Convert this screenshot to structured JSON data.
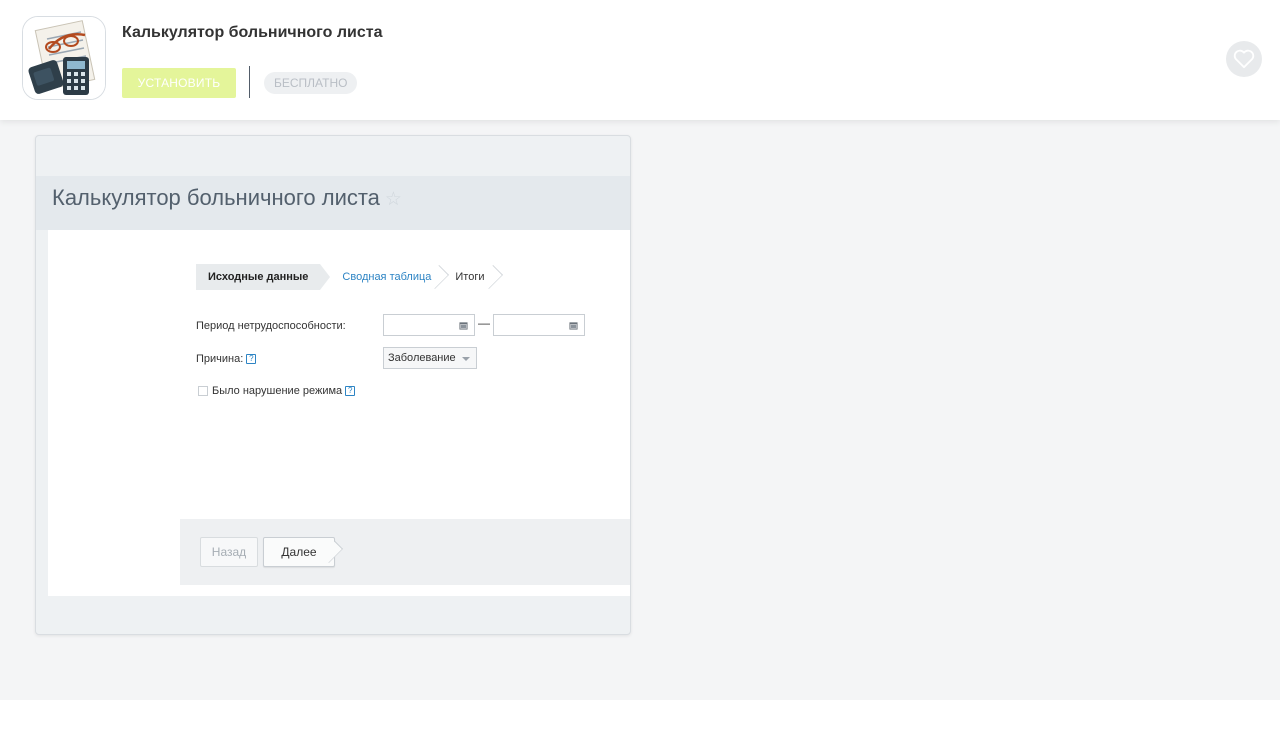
{
  "app": {
    "title": "Калькулятор больничного листа",
    "install_label": "УСТАНОВИТЬ",
    "price_label": "БЕСПЛАТНО",
    "icon": "calculator-app-icon",
    "favorite_icon": "heart-icon"
  },
  "screenshot": {
    "title": "Калькулятор больничного листа",
    "star": "☆",
    "steps": [
      {
        "label": "Исходные данные",
        "state": "active"
      },
      {
        "label": "Сводная таблица",
        "state": "link"
      },
      {
        "label": "Итоги",
        "state": "plain"
      }
    ],
    "form": {
      "period_label": "Период нетрудоспособности:",
      "date_from": "",
      "date_to": "",
      "dash": "—",
      "reason_label": "Причина:",
      "reason_value": "Заболевание",
      "violation_label": "Было нарушение режима",
      "help_glyph": "?"
    },
    "buttons": {
      "back": "Назад",
      "next": "Далее"
    }
  },
  "colors": {
    "install_bg": "#e4f59a",
    "link": "#2d84c4",
    "page_bg": "#f4f5f6"
  }
}
